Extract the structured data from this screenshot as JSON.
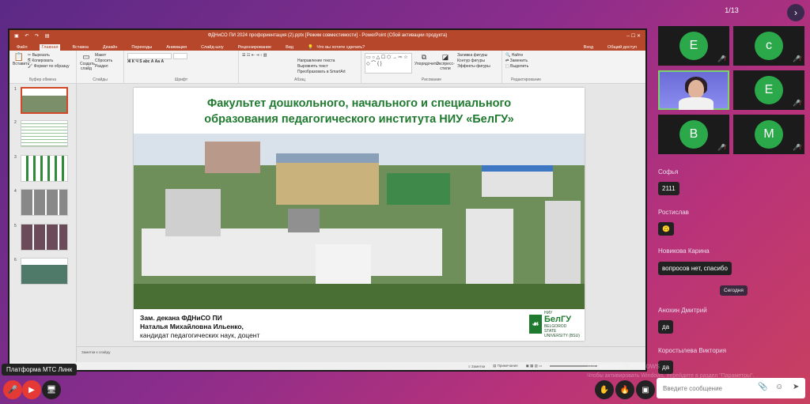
{
  "top": {
    "page_counter": "1/13",
    "next_icon": "chevron-right-icon"
  },
  "powerpoint": {
    "window_title": "ФДНиСО ПИ 2024 профориентация (2).pptx [Режим совместимости] - PowerPoint (Сбой активации продукта)",
    "login": "Вход",
    "share": "Общий доступ",
    "tabs": [
      "Файл",
      "Главная",
      "Вставка",
      "Дизайн",
      "Переходы",
      "Анимация",
      "Слайд-шоу",
      "Рецензирование",
      "Вид",
      "Что вы хотите сделать?"
    ],
    "active_tab": "Главная",
    "ribbon": {
      "clipboard": {
        "paste": "Вставить",
        "cut": "Вырезать",
        "copy": "Копировать",
        "format": "Формат по образцу",
        "label": "Буфер обмена"
      },
      "slides": {
        "new_slide": "Создать слайд",
        "layout": "Макет",
        "reset": "Сбросить",
        "section": "Раздел",
        "label": "Слайды"
      },
      "font": {
        "label": "Шрифт"
      },
      "paragraph": {
        "direction": "Направление текста",
        "align": "Выровнять текст",
        "smartart": "Преобразовать в SmartArt",
        "label": "Абзац"
      },
      "drawing": {
        "arrange": "Упорядочить",
        "styles": "Экспресс-стили",
        "fill": "Заливка фигуры",
        "outline": "Контур фигуры",
        "effects": "Эффекты фигуры",
        "label": "Рисование"
      },
      "editing": {
        "find": "Найти",
        "replace": "Заменить",
        "select": "Выделить",
        "label": "Редактирование"
      }
    },
    "slide_numbers": [
      "1",
      "2",
      "3",
      "4",
      "5",
      "6"
    ],
    "slide": {
      "title_line1": "Факультет дошкольного, начального и специального",
      "title_line2": "образования педагогического института НИУ «БелГУ»",
      "caption_line1": "Зам. декана ФДНиСО ПИ",
      "caption_line2": "Наталья Михайловна Ильенко,",
      "caption_line3": "кандидат педагогических наук, доцент",
      "logo_big": "БелГУ",
      "logo_small1": "НИУ",
      "logo_small2": "BELGOROD STATE",
      "logo_small3": "UNIVERSITY (BSU)"
    },
    "notes_placeholder": "Заметки к слайду",
    "status": {
      "notes": "Заметки",
      "comments": "Примечания"
    }
  },
  "participants": [
    {
      "initial": "E",
      "muted": true
    },
    {
      "initial": "c",
      "muted": true
    },
    {
      "initial": "",
      "camera": true
    },
    {
      "initial": "E",
      "muted": true
    },
    {
      "initial": "B",
      "muted": true
    },
    {
      "initial": "M",
      "muted": true
    }
  ],
  "chat": {
    "messages": [
      {
        "author": "Софья",
        "text": "2111"
      },
      {
        "author": "Ростислав",
        "text": "🙃"
      },
      {
        "author": "Новикова Карина",
        "text": "вопросов нет, спасибо"
      },
      {
        "author": "Анохин Дмитрий",
        "text": "да"
      },
      {
        "author": "Коростылева Виктория",
        "text": "да"
      }
    ],
    "date_badge": "Сегодня",
    "input_placeholder": "Введите сообщение",
    "watermark_line1": "Активация Windows",
    "watermark_line2": "Чтобы активировать Windows, перейдите в раздел \"Параметры\"."
  },
  "bottom": {
    "platform_label": "Платформа МТС Линк"
  },
  "colors": {
    "ppt_accent": "#b7472a",
    "slide_green": "#1f7a2f",
    "avatar_green": "#2ba84a",
    "mute_red": "#e53935"
  }
}
